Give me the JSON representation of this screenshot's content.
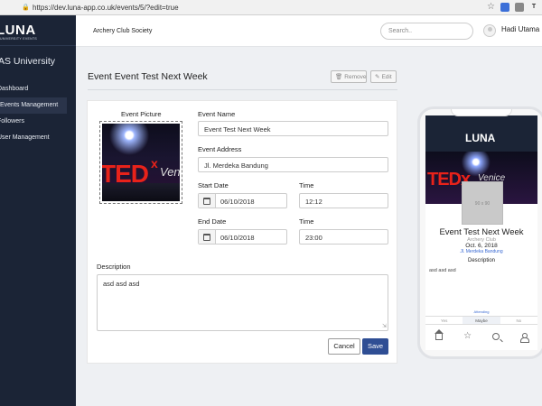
{
  "browser": {
    "url": "https://dev.luna-app.co.uk/events/5/?edit=true",
    "ext_t_label": "T"
  },
  "sidebar": {
    "logo": "LUNA",
    "logo_sub": "UNIVERSITY EVENTS",
    "university": "AS University",
    "items": [
      {
        "label": "Dashboard"
      },
      {
        "label": "Events Management"
      },
      {
        "label": "Followers"
      },
      {
        "label": "User Management"
      }
    ]
  },
  "header": {
    "organization": "Archery Club Society",
    "search_placeholder": "Search..",
    "user_name": "Hadi Utama"
  },
  "page": {
    "title": "Event Event Test Next Week",
    "remove_label": "Remove",
    "edit_label": "Edit"
  },
  "form": {
    "picture_label": "Event Picture",
    "picture_text_ted": "TED",
    "picture_text_x": "x",
    "picture_text_venue": "Veni",
    "name_label": "Event Name",
    "name_value": "Event Test Next Week",
    "address_label": "Event Address",
    "address_value": "Jl. Merdeka Bandung",
    "start_date_label": "Start Date",
    "start_date_value": "06/10/2018",
    "start_time_label": "Time",
    "start_time_value": "12:12",
    "end_date_label": "End Date",
    "end_date_value": "06/10/2018",
    "end_time_label": "Time",
    "end_time_value": "23:00",
    "description_label": "Description",
    "description_value": "asd asd asd",
    "cancel_label": "Cancel",
    "save_label": "Save"
  },
  "preview": {
    "logo": "LUNA",
    "banner_text_ted": "TEDx",
    "banner_text_venue": "Venice",
    "thumb_label": "90 x 90",
    "title": "Event Test Next Week",
    "club": "Archery Club",
    "date": "Oct. 6, 2018",
    "address": "Jl. Merdeka Bandung",
    "description_heading": "Description",
    "description": "asd asd asd",
    "going_text": "Attending",
    "rsvp": [
      "Yes",
      "Maybe",
      "No"
    ]
  }
}
